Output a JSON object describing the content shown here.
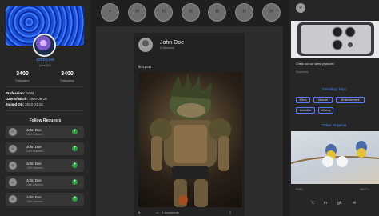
{
  "profile": {
    "name": "John Doe",
    "handle": "jdoe123",
    "followers_count": "3400",
    "followers_label": "Followers",
    "following_count": "3400",
    "following_label": "Following",
    "profession_label": "Profession:",
    "profession": "Artist",
    "dob_label": "Date of Birth:",
    "dob": "1990-08-16",
    "joined_label": "Joined On:",
    "joined": "2022-01-15"
  },
  "follow_requests": {
    "title": "Follow Requests",
    "items": [
      {
        "initial": "H",
        "name": "John Doe",
        "followers": "100K followers"
      },
      {
        "initial": "H",
        "name": "John Doe",
        "followers": "100K followers"
      },
      {
        "initial": "H",
        "name": "John Doe",
        "followers": "100K followers"
      },
      {
        "initial": "H",
        "name": "John Doe",
        "followers": "100K followers"
      },
      {
        "initial": "H",
        "name": "John Doe",
        "followers": "100K followers"
      }
    ]
  },
  "stories": {
    "add_label": "+",
    "items": [
      "H",
      "H",
      "H",
      "H",
      "H",
      "H",
      "H"
    ]
  },
  "post": {
    "author": "John Doe",
    "followers": "0 followers",
    "text": "first post",
    "comments": "0 comments"
  },
  "right": {
    "user_initial": "P",
    "ad_text": "Check out our latest products!",
    "ad_sponsor": "Sponsored",
    "trending_title": "Trending Tags",
    "tags": [
      "#Tech",
      "#Marvel",
      "#Entertainment",
      "#ArtistDrt",
      "#Calmg"
    ],
    "projects_title": "Other Projects",
    "pager_prev": "PREV",
    "pager_next": "NEXT >",
    "social": [
      "𝕏",
      "in",
      "gh",
      "✉"
    ]
  },
  "colors": {
    "accent": "#4a86ff",
    "add": "#2e9d46",
    "bg": "#1f1f1f",
    "panel": "#262626"
  }
}
